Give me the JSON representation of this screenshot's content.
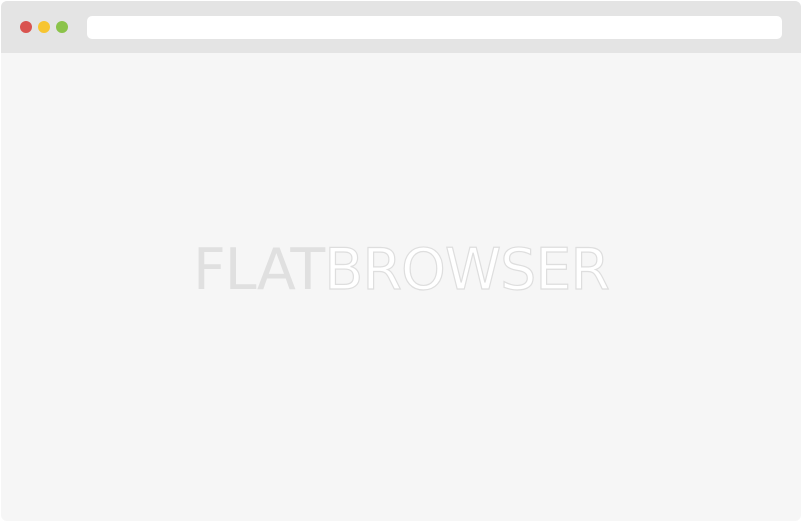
{
  "window": {
    "controls": {
      "close_color": "#d9534f",
      "minimize_color": "#f7c531",
      "maximize_color": "#8bc34a"
    },
    "address_bar": {
      "value": "",
      "placeholder": ""
    }
  },
  "content": {
    "logo": {
      "part1": "FLAT",
      "part2": "BROWSER"
    }
  }
}
